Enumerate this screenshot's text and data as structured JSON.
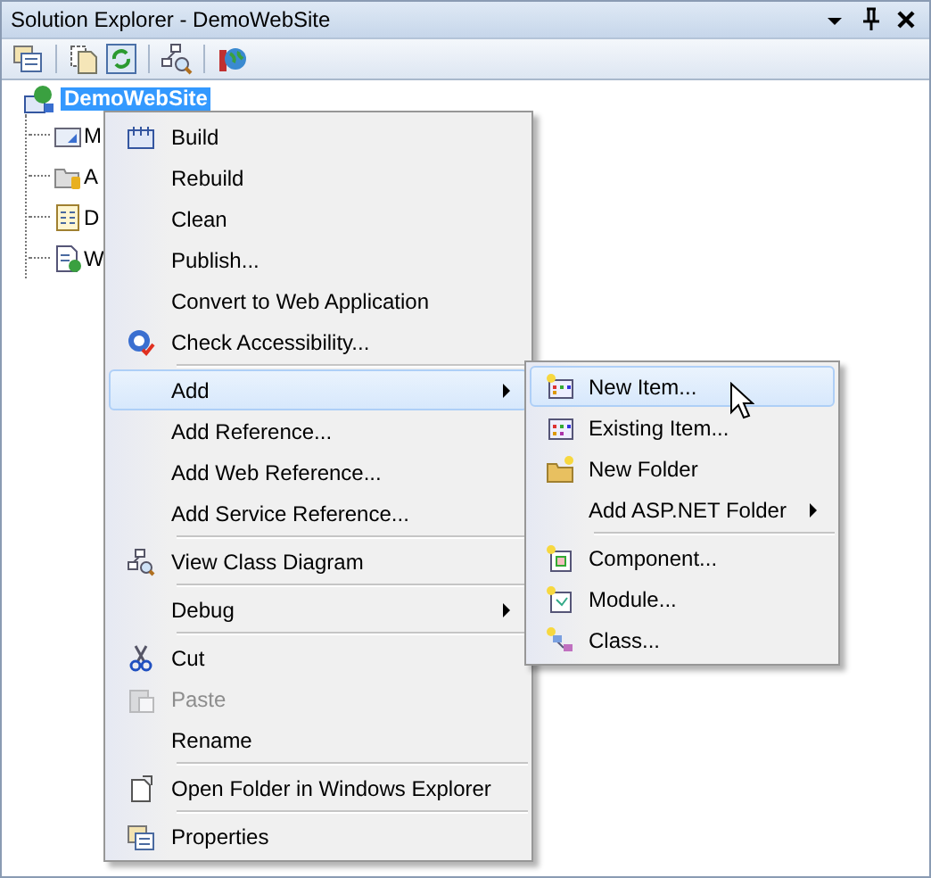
{
  "window": {
    "title": "Solution Explorer - DemoWebSite"
  },
  "toolbar": {
    "buttons": [
      {
        "kind": "button"
      },
      {
        "kind": "separator"
      },
      {
        "kind": "button"
      },
      {
        "kind": "button"
      },
      {
        "kind": "separator"
      },
      {
        "kind": "button"
      },
      {
        "kind": "separator"
      },
      {
        "kind": "button"
      }
    ]
  },
  "tree": {
    "root": {
      "label": "DemoWebSite",
      "selected": true,
      "expanded": true,
      "children": [
        {
          "label": "M"
        },
        {
          "label": "A"
        },
        {
          "label": "D"
        },
        {
          "label": "W"
        }
      ]
    }
  },
  "context_menu": {
    "items": [
      {
        "kind": "item",
        "label": "Build",
        "disabled": false,
        "selected": false,
        "submenu": false
      },
      {
        "kind": "item",
        "label": "Rebuild",
        "disabled": false,
        "selected": false,
        "submenu": false
      },
      {
        "kind": "item",
        "label": "Clean",
        "disabled": false,
        "selected": false,
        "submenu": false
      },
      {
        "kind": "item",
        "label": "Publish...",
        "disabled": false,
        "selected": false,
        "submenu": false
      },
      {
        "kind": "item",
        "label": "Convert to Web Application",
        "disabled": false,
        "selected": false,
        "submenu": false
      },
      {
        "kind": "item",
        "label": "Check Accessibility...",
        "disabled": false,
        "selected": false,
        "submenu": false
      },
      {
        "kind": "separator"
      },
      {
        "kind": "item",
        "label": "Add",
        "disabled": false,
        "selected": true,
        "submenu": true
      },
      {
        "kind": "item",
        "label": "Add Reference...",
        "disabled": false,
        "selected": false,
        "submenu": false
      },
      {
        "kind": "item",
        "label": "Add Web Reference...",
        "disabled": false,
        "selected": false,
        "submenu": false
      },
      {
        "kind": "item",
        "label": "Add Service Reference...",
        "disabled": false,
        "selected": false,
        "submenu": false
      },
      {
        "kind": "separator"
      },
      {
        "kind": "item",
        "label": "View Class Diagram",
        "disabled": false,
        "selected": false,
        "submenu": false
      },
      {
        "kind": "separator"
      },
      {
        "kind": "item",
        "label": "Debug",
        "disabled": false,
        "selected": false,
        "submenu": true
      },
      {
        "kind": "separator"
      },
      {
        "kind": "item",
        "label": "Cut",
        "disabled": false,
        "selected": false,
        "submenu": false
      },
      {
        "kind": "item",
        "label": "Paste",
        "disabled": true,
        "selected": false,
        "submenu": false
      },
      {
        "kind": "item",
        "label": "Rename",
        "disabled": false,
        "selected": false,
        "submenu": false
      },
      {
        "kind": "separator"
      },
      {
        "kind": "item",
        "label": "Open Folder in Windows Explorer",
        "disabled": false,
        "selected": false,
        "submenu": false
      },
      {
        "kind": "separator"
      },
      {
        "kind": "item",
        "label": "Properties",
        "disabled": false,
        "selected": false,
        "submenu": false
      }
    ]
  },
  "submenu": {
    "items": [
      {
        "kind": "item",
        "label": "New Item...",
        "selected": true,
        "submenu": false
      },
      {
        "kind": "item",
        "label": "Existing Item...",
        "selected": false,
        "submenu": false
      },
      {
        "kind": "item",
        "label": "New Folder",
        "selected": false,
        "submenu": false
      },
      {
        "kind": "item",
        "label": "Add ASP.NET Folder",
        "selected": false,
        "submenu": true
      },
      {
        "kind": "separator"
      },
      {
        "kind": "item",
        "label": "Component...",
        "selected": false,
        "submenu": false
      },
      {
        "kind": "item",
        "label": "Module...",
        "selected": false,
        "submenu": false
      },
      {
        "kind": "item",
        "label": "Class...",
        "selected": false,
        "submenu": false
      }
    ]
  }
}
